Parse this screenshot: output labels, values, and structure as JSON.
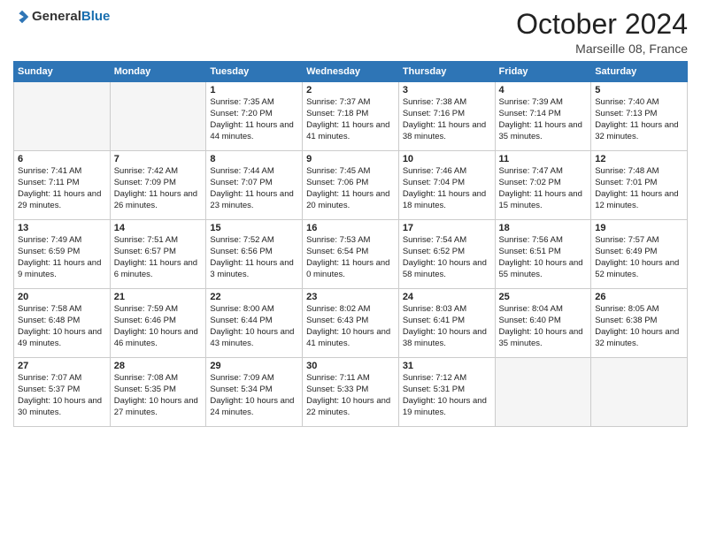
{
  "header": {
    "logo_general": "General",
    "logo_blue": "Blue",
    "month": "October 2024",
    "location": "Marseille 08, France"
  },
  "days_of_week": [
    "Sunday",
    "Monday",
    "Tuesday",
    "Wednesday",
    "Thursday",
    "Friday",
    "Saturday"
  ],
  "weeks": [
    [
      {
        "day": "",
        "empty": true
      },
      {
        "day": "",
        "empty": true
      },
      {
        "day": "1",
        "sunrise": "Sunrise: 7:35 AM",
        "sunset": "Sunset: 7:20 PM",
        "daylight": "Daylight: 11 hours and 44 minutes."
      },
      {
        "day": "2",
        "sunrise": "Sunrise: 7:37 AM",
        "sunset": "Sunset: 7:18 PM",
        "daylight": "Daylight: 11 hours and 41 minutes."
      },
      {
        "day": "3",
        "sunrise": "Sunrise: 7:38 AM",
        "sunset": "Sunset: 7:16 PM",
        "daylight": "Daylight: 11 hours and 38 minutes."
      },
      {
        "day": "4",
        "sunrise": "Sunrise: 7:39 AM",
        "sunset": "Sunset: 7:14 PM",
        "daylight": "Daylight: 11 hours and 35 minutes."
      },
      {
        "day": "5",
        "sunrise": "Sunrise: 7:40 AM",
        "sunset": "Sunset: 7:13 PM",
        "daylight": "Daylight: 11 hours and 32 minutes."
      }
    ],
    [
      {
        "day": "6",
        "sunrise": "Sunrise: 7:41 AM",
        "sunset": "Sunset: 7:11 PM",
        "daylight": "Daylight: 11 hours and 29 minutes."
      },
      {
        "day": "7",
        "sunrise": "Sunrise: 7:42 AM",
        "sunset": "Sunset: 7:09 PM",
        "daylight": "Daylight: 11 hours and 26 minutes."
      },
      {
        "day": "8",
        "sunrise": "Sunrise: 7:44 AM",
        "sunset": "Sunset: 7:07 PM",
        "daylight": "Daylight: 11 hours and 23 minutes."
      },
      {
        "day": "9",
        "sunrise": "Sunrise: 7:45 AM",
        "sunset": "Sunset: 7:06 PM",
        "daylight": "Daylight: 11 hours and 20 minutes."
      },
      {
        "day": "10",
        "sunrise": "Sunrise: 7:46 AM",
        "sunset": "Sunset: 7:04 PM",
        "daylight": "Daylight: 11 hours and 18 minutes."
      },
      {
        "day": "11",
        "sunrise": "Sunrise: 7:47 AM",
        "sunset": "Sunset: 7:02 PM",
        "daylight": "Daylight: 11 hours and 15 minutes."
      },
      {
        "day": "12",
        "sunrise": "Sunrise: 7:48 AM",
        "sunset": "Sunset: 7:01 PM",
        "daylight": "Daylight: 11 hours and 12 minutes."
      }
    ],
    [
      {
        "day": "13",
        "sunrise": "Sunrise: 7:49 AM",
        "sunset": "Sunset: 6:59 PM",
        "daylight": "Daylight: 11 hours and 9 minutes."
      },
      {
        "day": "14",
        "sunrise": "Sunrise: 7:51 AM",
        "sunset": "Sunset: 6:57 PM",
        "daylight": "Daylight: 11 hours and 6 minutes."
      },
      {
        "day": "15",
        "sunrise": "Sunrise: 7:52 AM",
        "sunset": "Sunset: 6:56 PM",
        "daylight": "Daylight: 11 hours and 3 minutes."
      },
      {
        "day": "16",
        "sunrise": "Sunrise: 7:53 AM",
        "sunset": "Sunset: 6:54 PM",
        "daylight": "Daylight: 11 hours and 0 minutes."
      },
      {
        "day": "17",
        "sunrise": "Sunrise: 7:54 AM",
        "sunset": "Sunset: 6:52 PM",
        "daylight": "Daylight: 10 hours and 58 minutes."
      },
      {
        "day": "18",
        "sunrise": "Sunrise: 7:56 AM",
        "sunset": "Sunset: 6:51 PM",
        "daylight": "Daylight: 10 hours and 55 minutes."
      },
      {
        "day": "19",
        "sunrise": "Sunrise: 7:57 AM",
        "sunset": "Sunset: 6:49 PM",
        "daylight": "Daylight: 10 hours and 52 minutes."
      }
    ],
    [
      {
        "day": "20",
        "sunrise": "Sunrise: 7:58 AM",
        "sunset": "Sunset: 6:48 PM",
        "daylight": "Daylight: 10 hours and 49 minutes."
      },
      {
        "day": "21",
        "sunrise": "Sunrise: 7:59 AM",
        "sunset": "Sunset: 6:46 PM",
        "daylight": "Daylight: 10 hours and 46 minutes."
      },
      {
        "day": "22",
        "sunrise": "Sunrise: 8:00 AM",
        "sunset": "Sunset: 6:44 PM",
        "daylight": "Daylight: 10 hours and 43 minutes."
      },
      {
        "day": "23",
        "sunrise": "Sunrise: 8:02 AM",
        "sunset": "Sunset: 6:43 PM",
        "daylight": "Daylight: 10 hours and 41 minutes."
      },
      {
        "day": "24",
        "sunrise": "Sunrise: 8:03 AM",
        "sunset": "Sunset: 6:41 PM",
        "daylight": "Daylight: 10 hours and 38 minutes."
      },
      {
        "day": "25",
        "sunrise": "Sunrise: 8:04 AM",
        "sunset": "Sunset: 6:40 PM",
        "daylight": "Daylight: 10 hours and 35 minutes."
      },
      {
        "day": "26",
        "sunrise": "Sunrise: 8:05 AM",
        "sunset": "Sunset: 6:38 PM",
        "daylight": "Daylight: 10 hours and 32 minutes."
      }
    ],
    [
      {
        "day": "27",
        "sunrise": "Sunrise: 7:07 AM",
        "sunset": "Sunset: 5:37 PM",
        "daylight": "Daylight: 10 hours and 30 minutes."
      },
      {
        "day": "28",
        "sunrise": "Sunrise: 7:08 AM",
        "sunset": "Sunset: 5:35 PM",
        "daylight": "Daylight: 10 hours and 27 minutes."
      },
      {
        "day": "29",
        "sunrise": "Sunrise: 7:09 AM",
        "sunset": "Sunset: 5:34 PM",
        "daylight": "Daylight: 10 hours and 24 minutes."
      },
      {
        "day": "30",
        "sunrise": "Sunrise: 7:11 AM",
        "sunset": "Sunset: 5:33 PM",
        "daylight": "Daylight: 10 hours and 22 minutes."
      },
      {
        "day": "31",
        "sunrise": "Sunrise: 7:12 AM",
        "sunset": "Sunset: 5:31 PM",
        "daylight": "Daylight: 10 hours and 19 minutes."
      },
      {
        "day": "",
        "empty": true
      },
      {
        "day": "",
        "empty": true
      }
    ]
  ]
}
